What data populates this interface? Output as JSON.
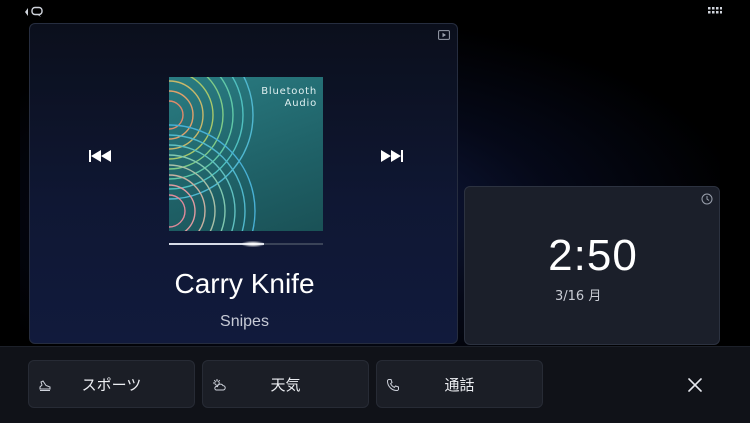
{
  "status_bar": {
    "left_icon": "back-message-icon",
    "right_icon": "apps-grid-icon"
  },
  "media": {
    "source_icon": "video-play-icon",
    "album_art_text_line1": "Bluetooth",
    "album_art_text_line2": "Audio",
    "track_title": "Carry Knife",
    "artist": "Snipes",
    "progress": 0.62,
    "prev_icon": "skip-previous-icon",
    "next_icon": "skip-next-icon"
  },
  "clock": {
    "time": "2:50",
    "date": "3/16  月",
    "icon": "clock-icon"
  },
  "shortcuts": [
    {
      "label": "スポーツ",
      "icon": "sports-shoe-icon"
    },
    {
      "label": "天気",
      "icon": "weather-cloud-sun-icon"
    },
    {
      "label": "通話",
      "icon": "phone-icon"
    }
  ],
  "close_icon": "close-icon",
  "colors": {
    "background": "#000000",
    "card": "#1b1f2a",
    "album_art": "#236b71",
    "accent_text": "#ffffff"
  }
}
